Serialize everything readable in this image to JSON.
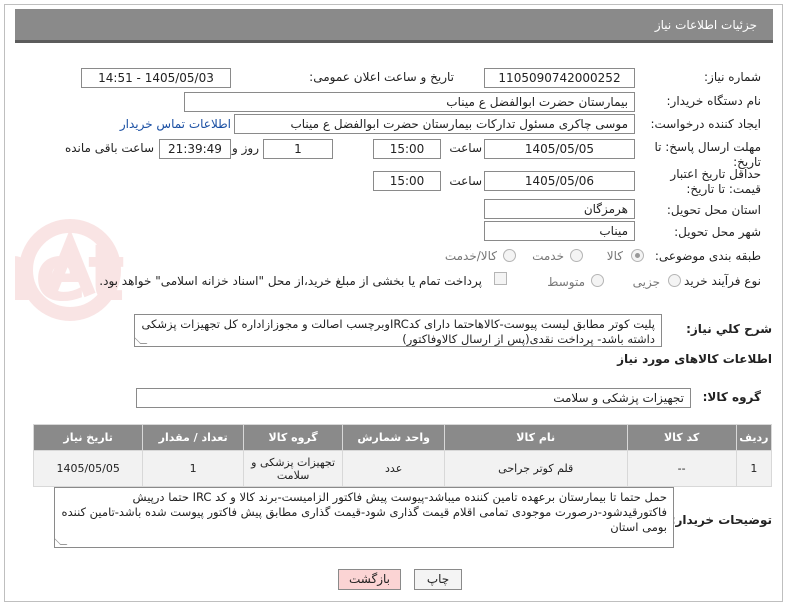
{
  "header": {
    "title": "جزئیات اطلاعات نیاز"
  },
  "need_number": {
    "label": "شماره نیاز:",
    "value": "1105090742000252"
  },
  "announce": {
    "label": "تاریخ و ساعت اعلان عمومی:",
    "value": "1405/05/03 - 14:51"
  },
  "buyer_org": {
    "label": "نام دستگاه خریدار:",
    "value": "بیمارستان حضرت ابوالفضل ع  میناب"
  },
  "creator": {
    "label": "ایجاد کننده درخواست:",
    "value": "موسی چاکری مسئول تداركات بيمارستان حضرت ابوالفضل ع  میناب",
    "contact_link": "اطلاعات تماس خریدار"
  },
  "deadline": {
    "label": "مهلت ارسال پاسخ: تا تاریخ:",
    "date": "1405/05/05",
    "time_label": "ساعت",
    "time": "15:00",
    "days": "1",
    "days_label": "روز و",
    "remaining": "21:39:49",
    "remaining_label": "ساعت باقی مانده"
  },
  "validity": {
    "label": "حداقل تاریخ اعتبار قیمت: تا تاریخ:",
    "date": "1405/05/06",
    "time_label": "ساعت",
    "time": "15:00"
  },
  "province": {
    "label": "استان محل تحویل:",
    "value": "هرمزگان"
  },
  "city": {
    "label": "شهر محل تحویل:",
    "value": "میناب"
  },
  "category": {
    "label": "طبقه بندی موضوعی:",
    "options": [
      "کالا",
      "خدمت",
      "کالا/خدمت"
    ],
    "selected": "کالا"
  },
  "process": {
    "label": "نوع فرآیند خرید :",
    "options": [
      "جزیی",
      "متوسط"
    ],
    "payment_text": "پرداخت تمام یا بخشی از مبلغ خرید،از محل \"اسناد خزانه اسلامی\" خواهد بود."
  },
  "description": {
    "label": "شرح كلي نياز:",
    "value": "پلیت کوتر مطابق لیست پیوست-کالاهاحتما دارای کدIRCوبرچسب اصالت و مجوزازاداره کل تجهیزات پزشکی داشته باشد- پرداخت نقدی(پس از ارسال کالاوفاکتور)"
  },
  "goods_info": {
    "title": "اطلاعات کالاهای مورد نیاز"
  },
  "goods_group": {
    "label": "گروه کالا:",
    "value": "تجهیزات پزشکی و سلامت"
  },
  "table": {
    "headers": [
      "ردیف",
      "کد کالا",
      "نام کالا",
      "واحد شمارش",
      "گروه کالا",
      "تعداد / مقدار",
      "تاریخ نیاز"
    ],
    "rows": [
      [
        "1",
        "--",
        "قلم کوتر جراحی",
        "عدد",
        "تجهیزات پزشکی و سلامت",
        "1",
        "1405/05/05"
      ]
    ]
  },
  "buyer_notes": {
    "label": "توضیحات خریدار:",
    "value": "حمل حتما تا بیمارستان برعهده تامین کننده میباشد-پیوست پیش فاکتور الزامیست-برند کالا و کد IRC حتما درپیش فاکتورقیدشود-درصورت موجودی تمامی اقلام قیمت گذاری شود-قیمت گذاری مطابق پیش فاکتور پیوست شده باشد-تامین کننده بومی استان"
  },
  "buttons": {
    "print": "چاپ",
    "back": "بازگشت"
  },
  "watermark_text": "AriaTender.net"
}
